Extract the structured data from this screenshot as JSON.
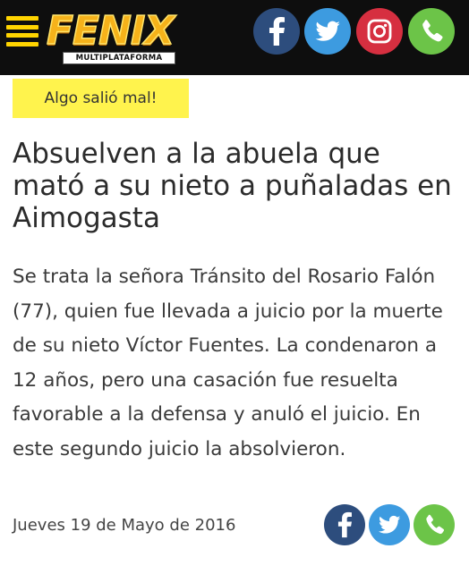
{
  "header": {
    "menu_icon": "hamburger-menu-icon",
    "logo_text": "FENIX",
    "logo_tagline": "MULTIPLATAFORMA",
    "brand_color": "#ffd400",
    "social": [
      {
        "name": "facebook",
        "icon": "facebook-icon",
        "color": "#2d4d7d"
      },
      {
        "name": "twitter",
        "icon": "twitter-icon",
        "color": "#3d9be0"
      },
      {
        "name": "instagram",
        "icon": "instagram-icon",
        "color": "#d62f40"
      },
      {
        "name": "whatsapp",
        "icon": "whatsapp-phone-icon",
        "color": "#6cc448"
      }
    ]
  },
  "alert": {
    "text": "Algo salió mal!",
    "background": "#fff34d"
  },
  "article": {
    "title": "Absuelven a la abuela que mató a su nieto a puñaladas en Aimogasta",
    "summary": "Se trata la señora Tránsito del Rosario Falón (77), quien fue llevada a juicio por la muerte de su nieto Víctor Fuentes. La condenaron a 12 años, pero una casación fue resuelta favorable a la defensa y anuló el juicio. En este segundo juicio la absolvieron.",
    "date": "Jueves 19 de Mayo de 2016"
  },
  "share": [
    {
      "name": "facebook",
      "icon": "facebook-icon"
    },
    {
      "name": "twitter",
      "icon": "twitter-icon"
    },
    {
      "name": "whatsapp",
      "icon": "whatsapp-phone-icon"
    }
  ]
}
